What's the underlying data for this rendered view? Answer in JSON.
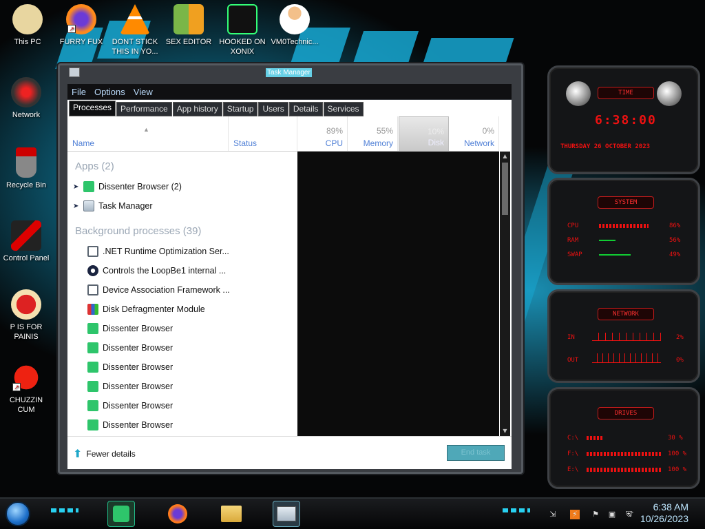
{
  "desktop": {
    "icons": [
      {
        "label": "This PC"
      },
      {
        "label": "FURRY FUX"
      },
      {
        "label": "DONT STICK THIS IN YO..."
      },
      {
        "label": "SEX EDITOR"
      },
      {
        "label": "HOOKED ON XONIX"
      },
      {
        "label": "VM0Technic..."
      },
      {
        "label": "Network"
      },
      {
        "label": "Recycle Bin"
      },
      {
        "label": "Control Panel"
      },
      {
        "label": "P IS FOR PAINIS"
      },
      {
        "label": "CHUZZIN CUM"
      }
    ]
  },
  "window": {
    "title": "Task Manager",
    "menu": [
      "File",
      "Options",
      "View"
    ],
    "tabs": [
      "Processes",
      "Performance",
      "App history",
      "Startup",
      "Users",
      "Details",
      "Services"
    ],
    "active_tab": "Processes",
    "columns": {
      "name": "Name",
      "status": "Status",
      "cpu": {
        "label": "CPU",
        "percent": "89%"
      },
      "memory": {
        "label": "Memory",
        "percent": "55%"
      },
      "disk": {
        "label": "Disk",
        "percent": "10%"
      },
      "network": {
        "label": "Network",
        "percent": "0%"
      }
    },
    "groups": {
      "apps": "Apps (2)",
      "background": "Background processes (39)"
    },
    "apps": [
      {
        "name": "Dissenter Browser (2)",
        "icon": "dissenter-icon"
      },
      {
        "name": "Task Manager",
        "icon": "task-manager-icon"
      }
    ],
    "background": [
      {
        "name": ".NET Runtime Optimization Ser...",
        "icon": "service-window-icon"
      },
      {
        "name": "Controls the LoopBe1 internal ...",
        "icon": "loopbe-icon"
      },
      {
        "name": "Device Association Framework ...",
        "icon": "service-window-icon"
      },
      {
        "name": "Disk Defragmenter Module",
        "icon": "defrag-icon"
      },
      {
        "name": "Dissenter Browser",
        "icon": "dissenter-icon"
      },
      {
        "name": "Dissenter Browser",
        "icon": "dissenter-icon"
      },
      {
        "name": "Dissenter Browser",
        "icon": "dissenter-icon"
      },
      {
        "name": "Dissenter Browser",
        "icon": "dissenter-icon"
      },
      {
        "name": "Dissenter Browser",
        "icon": "dissenter-icon"
      },
      {
        "name": "Dissenter Browser",
        "icon": "dissenter-icon"
      }
    ],
    "footer": {
      "fewer_details": "Fewer details",
      "end_task": "End task"
    }
  },
  "gadgets": {
    "time": {
      "title": "TIME",
      "clock": "6:38:00",
      "date": "THURSDAY 26 OCTOBER 2023"
    },
    "system": {
      "title": "SYSTEM",
      "rows": [
        {
          "label": "CPU",
          "value": "86%",
          "level": 0.86
        },
        {
          "label": "RAM",
          "value": "56%",
          "level": 0.56
        },
        {
          "label": "SWAP",
          "value": "49%",
          "level": 0.49
        }
      ]
    },
    "network": {
      "title": "NETWORK",
      "rows": [
        {
          "label": "IN",
          "value": "2%"
        },
        {
          "label": "OUT",
          "value": "0%"
        }
      ]
    },
    "drives": {
      "title": "DRIVES",
      "rows": [
        {
          "label": "C:\\",
          "value": "30 %",
          "level": 0.3
        },
        {
          "label": "F:\\",
          "value": "100 %",
          "level": 1.0
        },
        {
          "label": "E:\\",
          "value": "100 %",
          "level": 1.0
        }
      ]
    }
  },
  "taskbar": {
    "time": "6:38 AM",
    "date": "10/26/2023",
    "pinned": [
      "dissenter-icon",
      "firefox-icon",
      "file-explorer-icon",
      "task-manager-icon"
    ]
  },
  "colors": {
    "accent": "#18a8d2",
    "gadget_red": "#e11111",
    "header_blue": "#4f7fd6"
  }
}
